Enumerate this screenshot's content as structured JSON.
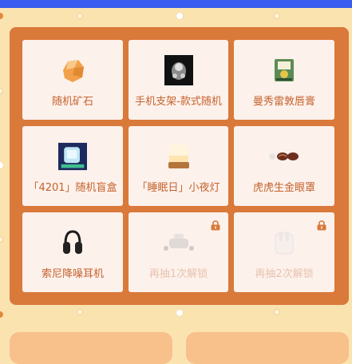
{
  "colors": {
    "top_bar": "#3a5cf0",
    "board": "#d9793a",
    "cell": "#fdf1ec",
    "label": "#c4632d",
    "background": "#fbe3b0"
  },
  "prizes": [
    {
      "name": "随机矿石",
      "icon": "ore-icon",
      "locked": false
    },
    {
      "name": "手机支架-款式随机",
      "icon": "phone-stand-icon",
      "locked": false
    },
    {
      "name": "曼秀雷敦唇膏",
      "icon": "lip-balm-icon",
      "locked": false
    },
    {
      "name": "「4201」随机盲盒",
      "icon": "blind-box-icon",
      "locked": false
    },
    {
      "name": "「睡眠日」小夜灯",
      "icon": "night-light-icon",
      "locked": false
    },
    {
      "name": "虎虎生金眼罩",
      "icon": "eye-mask-icon",
      "locked": false
    },
    {
      "name": "索尼降噪耳机",
      "icon": "headphones-icon",
      "locked": false
    },
    {
      "name": "再抽1次解锁",
      "icon": "vr-headset-icon",
      "locked": true
    },
    {
      "name": "再抽2次解锁",
      "icon": "earbuds-icon",
      "locked": true
    }
  ]
}
